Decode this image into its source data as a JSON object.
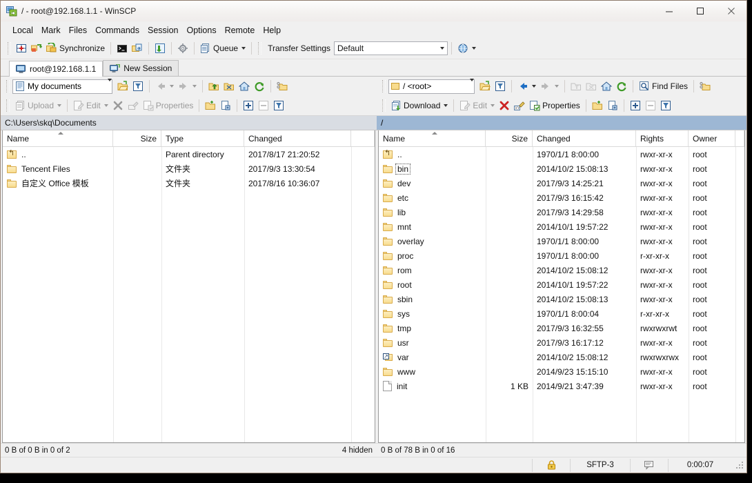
{
  "window": {
    "title": "/ - root@192.168.1.1 - WinSCP",
    "app_icon": "winscp-icon",
    "minimize": "—",
    "maximize": "☐",
    "close": "✕"
  },
  "menubar": {
    "items": [
      {
        "label": "Local",
        "name": "menu-local"
      },
      {
        "label": "Mark",
        "name": "menu-mark"
      },
      {
        "label": "Files",
        "name": "menu-files"
      },
      {
        "label": "Commands",
        "name": "menu-commands"
      },
      {
        "label": "Session",
        "name": "menu-session"
      },
      {
        "label": "Options",
        "name": "menu-options"
      },
      {
        "label": "Remote",
        "name": "menu-remote"
      },
      {
        "label": "Help",
        "name": "menu-help"
      }
    ]
  },
  "toolbar": {
    "new_tab_label": "",
    "synchronize_label": "Synchronize",
    "queue_label": "Queue",
    "transfer_settings_label": "Transfer Settings",
    "transfer_settings_value": "Default"
  },
  "tabs": [
    {
      "label": "root@192.168.1.1",
      "active": true,
      "icon": "session-icon"
    },
    {
      "label": "New Session",
      "active": false,
      "icon": "new-session-icon"
    }
  ],
  "left_panel": {
    "path_combo_value": "My documents",
    "path_bar": "C:\\Users\\skq\\Documents",
    "toolbar": {
      "upload_label": "Upload",
      "edit_label": "Edit",
      "properties_label": "Properties"
    },
    "columns": [
      {
        "label": "Name",
        "key": "name",
        "sorted": "asc"
      },
      {
        "label": "Size",
        "key": "size",
        "align": "right"
      },
      {
        "label": "Type",
        "key": "type"
      },
      {
        "label": "Changed",
        "key": "changed"
      }
    ],
    "rows": [
      {
        "name": "..",
        "icon": "parent-folder-icon",
        "size": "",
        "type": "Parent directory",
        "changed": "2017/8/17  21:20:52"
      },
      {
        "name": "Tencent Files",
        "icon": "folder-icon",
        "size": "",
        "type": "文件夹",
        "changed": "2017/9/3  13:30:54"
      },
      {
        "name": "自定义 Office 模板",
        "icon": "folder-icon",
        "size": "",
        "type": "文件夹",
        "changed": "2017/8/16  10:36:07"
      }
    ],
    "status": "0 B of 0 B in 0 of 2",
    "hidden_status": "4 hidden"
  },
  "right_panel": {
    "path_combo_value": "/ <root>",
    "path_bar": "/",
    "find_files_label": "Find Files",
    "toolbar": {
      "download_label": "Download",
      "edit_label": "Edit",
      "properties_label": "Properties"
    },
    "columns": [
      {
        "label": "Name",
        "key": "name",
        "sorted": "asc"
      },
      {
        "label": "Size",
        "key": "size",
        "align": "right"
      },
      {
        "label": "Changed",
        "key": "changed"
      },
      {
        "label": "Rights",
        "key": "rights"
      },
      {
        "label": "Owner",
        "key": "owner"
      }
    ],
    "rows": [
      {
        "name": "..",
        "icon": "parent-folder-icon",
        "size": "",
        "changed": "1970/1/1 8:00:00",
        "rights": "rwxr-xr-x",
        "owner": "root"
      },
      {
        "name": "bin",
        "icon": "folder-icon",
        "size": "",
        "changed": "2014/10/2 15:08:13",
        "rights": "rwxr-xr-x",
        "owner": "root",
        "focused": true
      },
      {
        "name": "dev",
        "icon": "folder-icon",
        "size": "",
        "changed": "2017/9/3 14:25:21",
        "rights": "rwxr-xr-x",
        "owner": "root"
      },
      {
        "name": "etc",
        "icon": "folder-icon",
        "size": "",
        "changed": "2017/9/3 16:15:42",
        "rights": "rwxr-xr-x",
        "owner": "root"
      },
      {
        "name": "lib",
        "icon": "folder-icon",
        "size": "",
        "changed": "2017/9/3 14:29:58",
        "rights": "rwxr-xr-x",
        "owner": "root"
      },
      {
        "name": "mnt",
        "icon": "folder-icon",
        "size": "",
        "changed": "2014/10/1 19:57:22",
        "rights": "rwxr-xr-x",
        "owner": "root"
      },
      {
        "name": "overlay",
        "icon": "folder-icon",
        "size": "",
        "changed": "1970/1/1 8:00:00",
        "rights": "rwxr-xr-x",
        "owner": "root"
      },
      {
        "name": "proc",
        "icon": "folder-icon",
        "size": "",
        "changed": "1970/1/1 8:00:00",
        "rights": "r-xr-xr-x",
        "owner": "root"
      },
      {
        "name": "rom",
        "icon": "folder-icon",
        "size": "",
        "changed": "2014/10/2 15:08:12",
        "rights": "rwxr-xr-x",
        "owner": "root"
      },
      {
        "name": "root",
        "icon": "folder-icon",
        "size": "",
        "changed": "2014/10/1 19:57:22",
        "rights": "rwxr-xr-x",
        "owner": "root"
      },
      {
        "name": "sbin",
        "icon": "folder-icon",
        "size": "",
        "changed": "2014/10/2 15:08:13",
        "rights": "rwxr-xr-x",
        "owner": "root"
      },
      {
        "name": "sys",
        "icon": "folder-icon",
        "size": "",
        "changed": "1970/1/1 8:00:04",
        "rights": "r-xr-xr-x",
        "owner": "root"
      },
      {
        "name": "tmp",
        "icon": "folder-icon",
        "size": "",
        "changed": "2017/9/3 16:32:55",
        "rights": "rwxrwxrwt",
        "owner": "root"
      },
      {
        "name": "usr",
        "icon": "folder-icon",
        "size": "",
        "changed": "2017/9/3 16:17:12",
        "rights": "rwxr-xr-x",
        "owner": "root"
      },
      {
        "name": "var",
        "icon": "symlink-folder-icon",
        "size": "",
        "changed": "2014/10/2 15:08:12",
        "rights": "rwxrwxrwx",
        "owner": "root"
      },
      {
        "name": "www",
        "icon": "folder-icon",
        "size": "",
        "changed": "2014/9/23 15:15:10",
        "rights": "rwxr-xr-x",
        "owner": "root"
      },
      {
        "name": "init",
        "icon": "file-icon",
        "size": "1 KB",
        "changed": "2014/9/21 3:47:39",
        "rights": "rwxr-xr-x",
        "owner": "root"
      }
    ],
    "status": "0 B of 78 B in 0 of 16"
  },
  "statusbar": {
    "lock_icon": "padlock-icon",
    "protocol": "SFTP-3",
    "message_icon": "console-icon",
    "duration": "0:00:07"
  },
  "colors": {
    "accent_blue": "#9db7d4",
    "inactive_path": "#d9dde3",
    "folder_yellow": "#f8dc8e",
    "window_border": "#9c8878"
  }
}
